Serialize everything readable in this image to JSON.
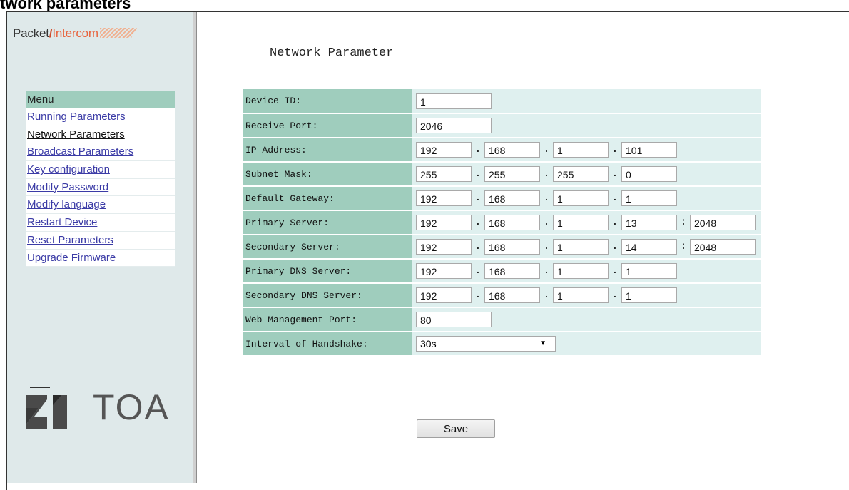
{
  "page_heading": "twork parameters",
  "logo": {
    "packet": "Packet",
    "slash": "/",
    "intercom": "Intercom"
  },
  "brand": "TOA",
  "menu": {
    "header": "Menu",
    "items": [
      {
        "label": "Running Parameters",
        "current": false
      },
      {
        "label": "Network Parameters",
        "current": true
      },
      {
        "label": "Broadcast Parameters",
        "current": false
      },
      {
        "label": "Key configuration",
        "current": false
      },
      {
        "label": "Modify Password",
        "current": false
      },
      {
        "label": "Modify language",
        "current": false
      },
      {
        "label": "Restart Device",
        "current": false
      },
      {
        "label": "Reset Parameters",
        "current": false
      },
      {
        "label": "Upgrade Firmware",
        "current": false
      }
    ]
  },
  "main": {
    "title": "Network Parameter",
    "save_label": "Save"
  },
  "fields": {
    "device_id": {
      "label": "Device ID:",
      "value": "1"
    },
    "receive_port": {
      "label": "Receive Port:",
      "value": "2046"
    },
    "ip_address": {
      "label": "IP Address:",
      "octets": [
        "192",
        "168",
        "1",
        "101"
      ]
    },
    "subnet_mask": {
      "label": "Subnet Mask:",
      "octets": [
        "255",
        "255",
        "255",
        "0"
      ]
    },
    "default_gateway": {
      "label": "Default Gateway:",
      "octets": [
        "192",
        "168",
        "1",
        "1"
      ]
    },
    "primary_server": {
      "label": "Primary Server:",
      "octets": [
        "192",
        "168",
        "1",
        "13"
      ],
      "port": "2048"
    },
    "secondary_server": {
      "label": "Secondary Server:",
      "octets": [
        "192",
        "168",
        "1",
        "14"
      ],
      "port": "2048"
    },
    "primary_dns": {
      "label": "Primary DNS Server:",
      "octets": [
        "192",
        "168",
        "1",
        "1"
      ]
    },
    "secondary_dns": {
      "label": "Secondary DNS Server:",
      "octets": [
        "192",
        "168",
        "1",
        "1"
      ]
    },
    "web_port": {
      "label": "Web Management Port:",
      "value": "80"
    },
    "handshake": {
      "label": "Interval of Handshake:",
      "value": "30s"
    }
  },
  "separators": {
    "dot": ".",
    "colon": ":"
  },
  "colors": {
    "label_bg": "#9fcdbd",
    "value_bg": "#dff0ef",
    "sidebar_bg": "#dfe9ea",
    "link": "#3b3ba6",
    "logo_accent": "#e8633d"
  }
}
